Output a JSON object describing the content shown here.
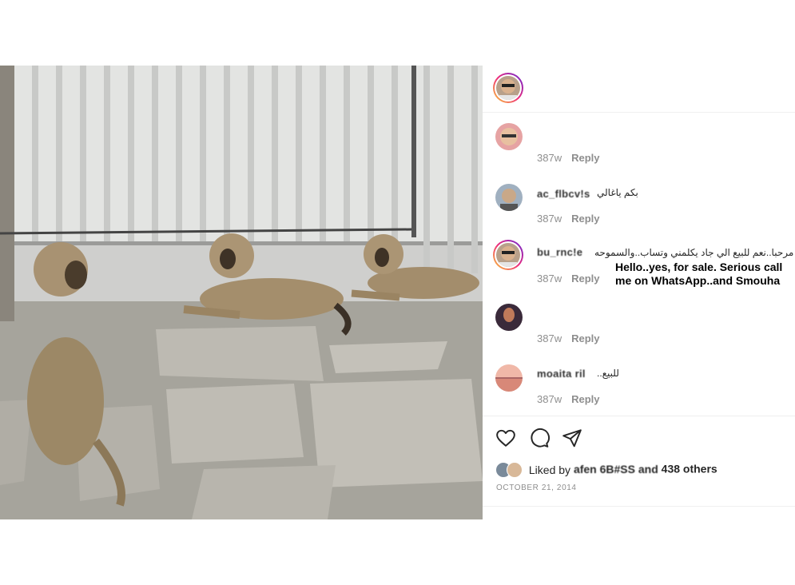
{
  "post": {
    "photo_alt": "",
    "author_avatar": "avatar"
  },
  "comments": [
    {
      "username": "",
      "text": "",
      "time": "387w",
      "reply_label": "Reply"
    },
    {
      "username": "ac_flbcv!s",
      "text": "بكم ياغالي",
      "time": "387w",
      "reply_label": "Reply"
    },
    {
      "username": "bu_rnc!e",
      "text": "مرحبا..نعم للبيع الي جاد يكلمني وتساب..والسموحه",
      "time": "387w",
      "reply_label": "Reply",
      "translation": "Hello..yes, for sale. Serious call me on WhatsApp..and Smouha"
    },
    {
      "username": "",
      "text": "",
      "time": "387w",
      "reply_label": "Reply"
    },
    {
      "username": "moaita ril",
      "text": "للبيع..",
      "time": "387w",
      "reply_label": "Reply"
    }
  ],
  "actions": {
    "like_icon": "heart-icon",
    "comment_icon": "comment-icon",
    "share_icon": "share-icon"
  },
  "likes": {
    "prefix": "Liked by",
    "name": "afen 6B#SS",
    "conjunction": "and",
    "others": "438 others"
  },
  "date": "OCTOBER 21, 2014",
  "colors": {
    "ring_start": "#f9ce34",
    "ring_mid": "#ee2a7b",
    "ring_end": "#6228d7",
    "muted": "#8e8e8e",
    "text": "#262626"
  }
}
